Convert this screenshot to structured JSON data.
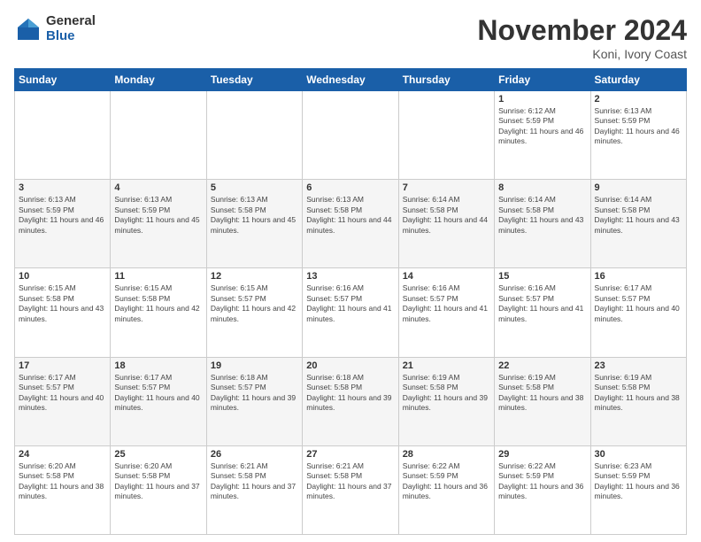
{
  "header": {
    "logo_general": "General",
    "logo_blue": "Blue",
    "title": "November 2024",
    "location": "Koni, Ivory Coast"
  },
  "weekdays": [
    "Sunday",
    "Monday",
    "Tuesday",
    "Wednesday",
    "Thursday",
    "Friday",
    "Saturday"
  ],
  "weeks": [
    [
      {
        "day": "",
        "info": ""
      },
      {
        "day": "",
        "info": ""
      },
      {
        "day": "",
        "info": ""
      },
      {
        "day": "",
        "info": ""
      },
      {
        "day": "",
        "info": ""
      },
      {
        "day": "1",
        "info": "Sunrise: 6:12 AM\nSunset: 5:59 PM\nDaylight: 11 hours and 46 minutes."
      },
      {
        "day": "2",
        "info": "Sunrise: 6:13 AM\nSunset: 5:59 PM\nDaylight: 11 hours and 46 minutes."
      }
    ],
    [
      {
        "day": "3",
        "info": "Sunrise: 6:13 AM\nSunset: 5:59 PM\nDaylight: 11 hours and 46 minutes."
      },
      {
        "day": "4",
        "info": "Sunrise: 6:13 AM\nSunset: 5:59 PM\nDaylight: 11 hours and 45 minutes."
      },
      {
        "day": "5",
        "info": "Sunrise: 6:13 AM\nSunset: 5:58 PM\nDaylight: 11 hours and 45 minutes."
      },
      {
        "day": "6",
        "info": "Sunrise: 6:13 AM\nSunset: 5:58 PM\nDaylight: 11 hours and 44 minutes."
      },
      {
        "day": "7",
        "info": "Sunrise: 6:14 AM\nSunset: 5:58 PM\nDaylight: 11 hours and 44 minutes."
      },
      {
        "day": "8",
        "info": "Sunrise: 6:14 AM\nSunset: 5:58 PM\nDaylight: 11 hours and 43 minutes."
      },
      {
        "day": "9",
        "info": "Sunrise: 6:14 AM\nSunset: 5:58 PM\nDaylight: 11 hours and 43 minutes."
      }
    ],
    [
      {
        "day": "10",
        "info": "Sunrise: 6:15 AM\nSunset: 5:58 PM\nDaylight: 11 hours and 43 minutes."
      },
      {
        "day": "11",
        "info": "Sunrise: 6:15 AM\nSunset: 5:58 PM\nDaylight: 11 hours and 42 minutes."
      },
      {
        "day": "12",
        "info": "Sunrise: 6:15 AM\nSunset: 5:57 PM\nDaylight: 11 hours and 42 minutes."
      },
      {
        "day": "13",
        "info": "Sunrise: 6:16 AM\nSunset: 5:57 PM\nDaylight: 11 hours and 41 minutes."
      },
      {
        "day": "14",
        "info": "Sunrise: 6:16 AM\nSunset: 5:57 PM\nDaylight: 11 hours and 41 minutes."
      },
      {
        "day": "15",
        "info": "Sunrise: 6:16 AM\nSunset: 5:57 PM\nDaylight: 11 hours and 41 minutes."
      },
      {
        "day": "16",
        "info": "Sunrise: 6:17 AM\nSunset: 5:57 PM\nDaylight: 11 hours and 40 minutes."
      }
    ],
    [
      {
        "day": "17",
        "info": "Sunrise: 6:17 AM\nSunset: 5:57 PM\nDaylight: 11 hours and 40 minutes."
      },
      {
        "day": "18",
        "info": "Sunrise: 6:17 AM\nSunset: 5:57 PM\nDaylight: 11 hours and 40 minutes."
      },
      {
        "day": "19",
        "info": "Sunrise: 6:18 AM\nSunset: 5:57 PM\nDaylight: 11 hours and 39 minutes."
      },
      {
        "day": "20",
        "info": "Sunrise: 6:18 AM\nSunset: 5:58 PM\nDaylight: 11 hours and 39 minutes."
      },
      {
        "day": "21",
        "info": "Sunrise: 6:19 AM\nSunset: 5:58 PM\nDaylight: 11 hours and 39 minutes."
      },
      {
        "day": "22",
        "info": "Sunrise: 6:19 AM\nSunset: 5:58 PM\nDaylight: 11 hours and 38 minutes."
      },
      {
        "day": "23",
        "info": "Sunrise: 6:19 AM\nSunset: 5:58 PM\nDaylight: 11 hours and 38 minutes."
      }
    ],
    [
      {
        "day": "24",
        "info": "Sunrise: 6:20 AM\nSunset: 5:58 PM\nDaylight: 11 hours and 38 minutes."
      },
      {
        "day": "25",
        "info": "Sunrise: 6:20 AM\nSunset: 5:58 PM\nDaylight: 11 hours and 37 minutes."
      },
      {
        "day": "26",
        "info": "Sunrise: 6:21 AM\nSunset: 5:58 PM\nDaylight: 11 hours and 37 minutes."
      },
      {
        "day": "27",
        "info": "Sunrise: 6:21 AM\nSunset: 5:58 PM\nDaylight: 11 hours and 37 minutes."
      },
      {
        "day": "28",
        "info": "Sunrise: 6:22 AM\nSunset: 5:59 PM\nDaylight: 11 hours and 36 minutes."
      },
      {
        "day": "29",
        "info": "Sunrise: 6:22 AM\nSunset: 5:59 PM\nDaylight: 11 hours and 36 minutes."
      },
      {
        "day": "30",
        "info": "Sunrise: 6:23 AM\nSunset: 5:59 PM\nDaylight: 11 hours and 36 minutes."
      }
    ]
  ]
}
